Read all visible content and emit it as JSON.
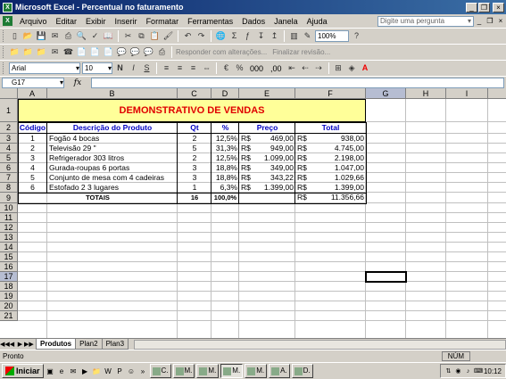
{
  "window": {
    "title": "Microsoft Excel - Percentual no faturamento"
  },
  "menubar": {
    "items": [
      "Arquivo",
      "Editar",
      "Exibir",
      "Inserir",
      "Formatar",
      "Ferramentas",
      "Dados",
      "Janela",
      "Ajuda"
    ],
    "ask_placeholder": "Digite uma pergunta"
  },
  "toolbar": {
    "zoom": "100%",
    "review_reply": "Responder com alterações...",
    "review_end": "Finalizar revisão..."
  },
  "format": {
    "font": "Arial",
    "size": "10",
    "bold": "N",
    "italic": "I",
    "underline": "S",
    "percent": "%",
    "thousands": "000",
    "decimal": ",00"
  },
  "formula_bar": {
    "name_box": "G17",
    "fx": "fx",
    "content": ""
  },
  "columns": [
    "A",
    "B",
    "C",
    "D",
    "E",
    "F",
    "G",
    "H",
    "I"
  ],
  "rows": [
    "1",
    "2",
    "3",
    "4",
    "5",
    "6",
    "7",
    "8",
    "9",
    "10",
    "11",
    "12",
    "13",
    "14",
    "15",
    "16",
    "17",
    "18",
    "19",
    "20",
    "21"
  ],
  "sheet": {
    "title": "DEMONSTRATIVO DE VENDAS",
    "headers": {
      "code": "Código",
      "desc": "Descrição do Produto",
      "qty": "Qt",
      "pct": "%",
      "price": "Preço",
      "total": "Total"
    },
    "rows": [
      {
        "code": "1",
        "desc": "Fogão 4 bocas",
        "qty": "2",
        "pct": "12,5%",
        "cur1": "R$",
        "price": "469,00",
        "cur2": "R$",
        "total": "938,00"
      },
      {
        "code": "2",
        "desc": "Televisão 29 \"",
        "qty": "5",
        "pct": "31,3%",
        "cur1": "R$",
        "price": "949,00",
        "cur2": "R$",
        "total": "4.745,00"
      },
      {
        "code": "3",
        "desc": "Refrigerador 303 litros",
        "qty": "2",
        "pct": "12,5%",
        "cur1": "R$",
        "price": "1.099,00",
        "cur2": "R$",
        "total": "2.198,00"
      },
      {
        "code": "4",
        "desc": "Gurada-roupas 6 portas",
        "qty": "3",
        "pct": "18,8%",
        "cur1": "R$",
        "price": "349,00",
        "cur2": "R$",
        "total": "1.047,00"
      },
      {
        "code": "5",
        "desc": "Conjunto de mesa com 4 cadeiras",
        "qty": "3",
        "pct": "18,8%",
        "cur1": "R$",
        "price": "343,22",
        "cur2": "R$",
        "total": "1.029,66"
      },
      {
        "code": "6",
        "desc": "Estofado 2 3 lugares",
        "qty": "1",
        "pct": "6,3%",
        "cur1": "R$",
        "price": "1.399,00",
        "cur2": "R$",
        "total": "1.399,00"
      }
    ],
    "totals": {
      "label": "TOTAIS",
      "qty": "16",
      "pct": "100,0%",
      "cur": "R$",
      "total": "11.356,66"
    }
  },
  "tabs": [
    "Produtos",
    "Plan2",
    "Plan3"
  ],
  "active_tab": "Produtos",
  "status": {
    "left": "Pronto",
    "num": "NÚM"
  },
  "taskbar": {
    "start": "Iniciar",
    "buttons": [
      "C.",
      "M.",
      "M.",
      "M.",
      "M.",
      "A.",
      "D."
    ],
    "clock": "10:12"
  }
}
